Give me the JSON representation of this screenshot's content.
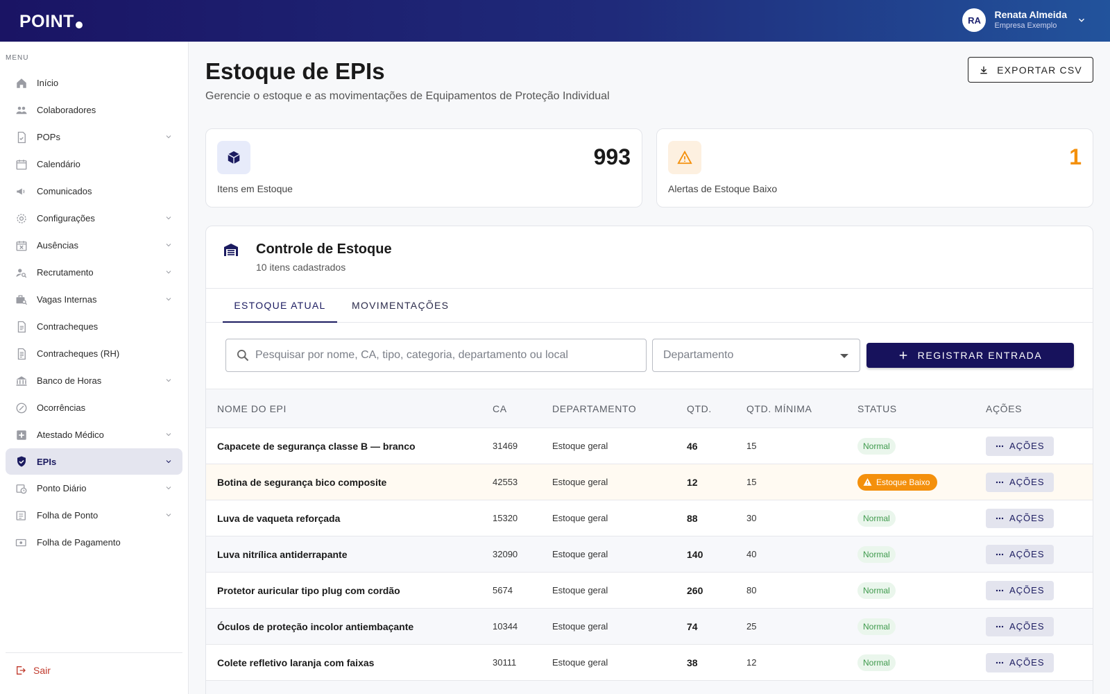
{
  "header": {
    "logo": "POINT",
    "user_initials": "RA",
    "user_name": "Renata Almeida",
    "user_company": "Empresa Exemplo"
  },
  "sidebar": {
    "menu_title": "MENU",
    "items": [
      {
        "label": "Início",
        "icon": "home-icon",
        "chevron": false
      },
      {
        "label": "Colaboradores",
        "icon": "people-icon",
        "chevron": false
      },
      {
        "label": "POPs",
        "icon": "document-check-icon",
        "chevron": true
      },
      {
        "label": "Calendário",
        "icon": "calendar-icon",
        "chevron": false
      },
      {
        "label": "Comunicados",
        "icon": "megaphone-icon",
        "chevron": false
      },
      {
        "label": "Configurações",
        "icon": "gear-icon",
        "chevron": true
      },
      {
        "label": "Ausências",
        "icon": "calendar-x-icon",
        "chevron": true
      },
      {
        "label": "Recrutamento",
        "icon": "person-search-icon",
        "chevron": true
      },
      {
        "label": "Vagas Internas",
        "icon": "briefcase-search-icon",
        "chevron": true
      },
      {
        "label": "Contracheques",
        "icon": "payslip-icon",
        "chevron": false
      },
      {
        "label": "Contracheques (RH)",
        "icon": "payslip-list-icon",
        "chevron": false
      },
      {
        "label": "Banco de Horas",
        "icon": "bank-icon",
        "chevron": true
      },
      {
        "label": "Ocorrências",
        "icon": "occurrence-icon",
        "chevron": false
      },
      {
        "label": "Atestado Médico",
        "icon": "medical-icon",
        "chevron": true
      },
      {
        "label": "EPIs",
        "icon": "shield-check-icon",
        "chevron": true,
        "active": true
      },
      {
        "label": "Ponto Diário",
        "icon": "calendar-clock-icon",
        "chevron": true
      },
      {
        "label": "Folha de Ponto",
        "icon": "timesheet-icon",
        "chevron": true
      },
      {
        "label": "Folha de Pagamento",
        "icon": "payment-icon",
        "chevron": false
      }
    ],
    "logout_label": "Sair"
  },
  "page": {
    "title": "Estoque de EPIs",
    "subtitle": "Gerencie o estoque e as movimentações de Equipamentos de Proteção Individual",
    "export_label": "EXPORTAR CSV"
  },
  "stats": {
    "items_value": "993",
    "items_label": "Itens em Estoque",
    "alerts_value": "1",
    "alerts_label": "Alertas de Estoque Baixo"
  },
  "panel": {
    "title": "Controle de Estoque",
    "subtitle": "10 itens cadastrados",
    "tabs": [
      "ESTOQUE ATUAL",
      "MOVIMENTAÇÕES"
    ],
    "search_placeholder": "Pesquisar por nome, CA, tipo, categoria, departamento ou local",
    "department_placeholder": "Departamento",
    "register_label": "REGISTRAR ENTRADA"
  },
  "table": {
    "headers": [
      "NOME DO EPI",
      "CA",
      "DEPARTAMENTO",
      "QTD.",
      "QTD. MÍNIMA",
      "STATUS",
      "AÇÕES"
    ],
    "action_label": "AÇÕES",
    "rows": [
      {
        "name": "Capacete de segurança classe B — branco",
        "ca": "31469",
        "dept": "Estoque geral",
        "qty": "46",
        "min": "15",
        "status": "Normal",
        "low": false
      },
      {
        "name": "Botina de segurança bico composite",
        "ca": "42553",
        "dept": "Estoque geral",
        "qty": "12",
        "min": "15",
        "status": "Estoque Baixo",
        "low": true
      },
      {
        "name": "Luva de vaqueta reforçada",
        "ca": "15320",
        "dept": "Estoque geral",
        "qty": "88",
        "min": "30",
        "status": "Normal",
        "low": false
      },
      {
        "name": "Luva nitrílica antiderrapante",
        "ca": "32090",
        "dept": "Estoque geral",
        "qty": "140",
        "min": "40",
        "status": "Normal",
        "low": false
      },
      {
        "name": "Protetor auricular tipo plug com cordão",
        "ca": "5674",
        "dept": "Estoque geral",
        "qty": "260",
        "min": "80",
        "status": "Normal",
        "low": false
      },
      {
        "name": "Óculos de proteção incolor antiembaçante",
        "ca": "10344",
        "dept": "Estoque geral",
        "qty": "74",
        "min": "25",
        "status": "Normal",
        "low": false
      },
      {
        "name": "Colete refletivo laranja com faixas",
        "ca": "30111",
        "dept": "Estoque geral",
        "qty": "38",
        "min": "12",
        "status": "Normal",
        "low": false
      }
    ]
  },
  "colors": {
    "brand": "#17125c",
    "warning": "#f4900c",
    "success": "#3f9a4d"
  }
}
